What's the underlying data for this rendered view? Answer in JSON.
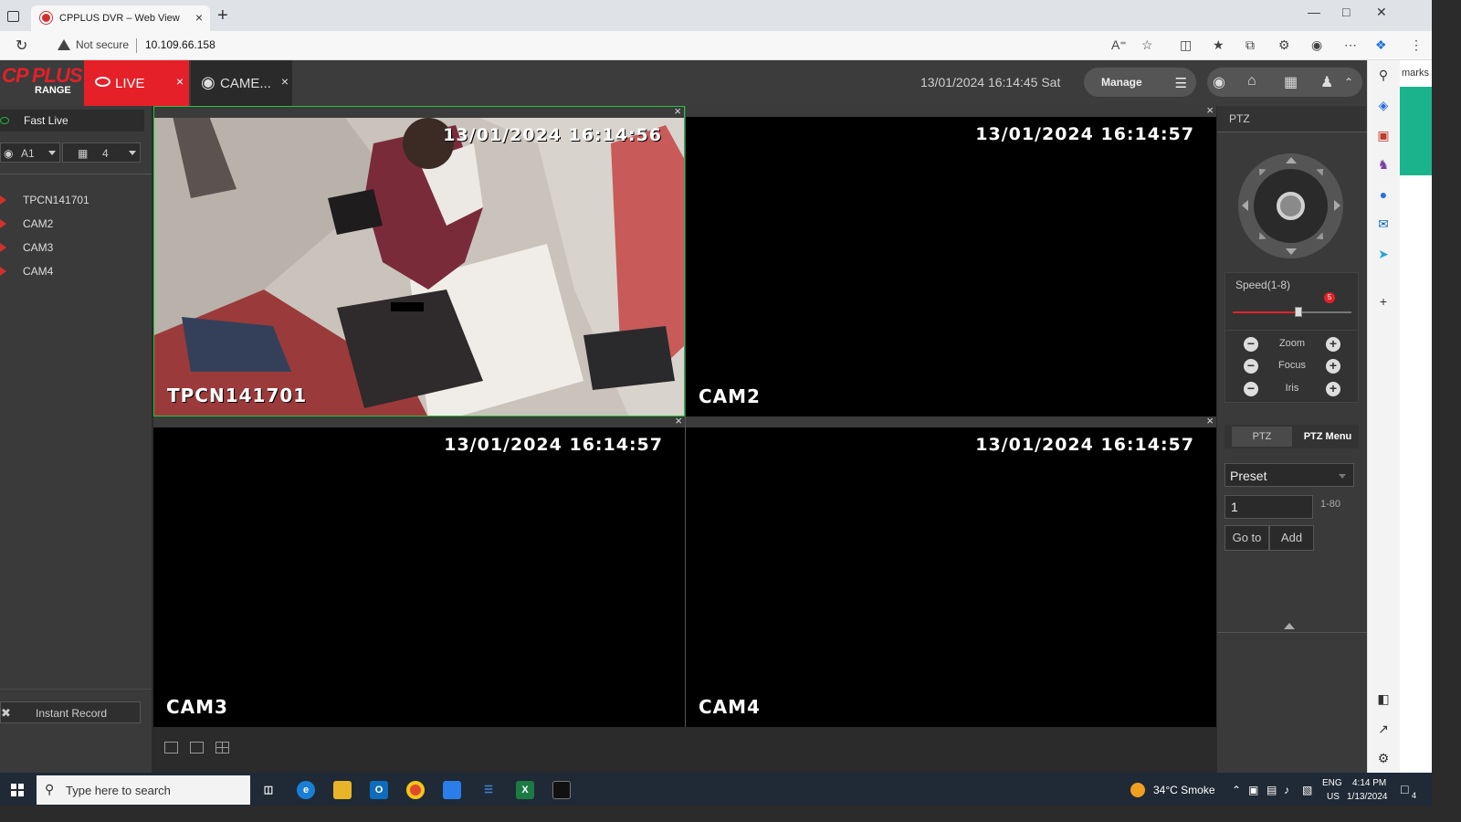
{
  "browser": {
    "tab_title": "CPPLUS DVR – Web View",
    "tab_close": "×",
    "new_tab": "+",
    "not_secure": "Not secure",
    "url": "10.109.66.158",
    "sidebar_partial_text": "marks"
  },
  "app": {
    "logo_brand": "CP PLUS",
    "logo_sub": "RANGE",
    "tabs": [
      {
        "label": "LIVE",
        "close": "×",
        "active": true
      },
      {
        "label": "CAME...",
        "close": "×",
        "active": false
      }
    ],
    "datetime": "13/01/2024 16:14:45 Sat",
    "manage_label": "Manage",
    "accent_color": "#e52028"
  },
  "left_panel": {
    "fast_live": "Fast Live",
    "channel_select": "A1",
    "layout_select": "4",
    "cameras": [
      "TPCN141701",
      "CAM2",
      "CAM3",
      "CAM4"
    ],
    "instant_record": "Instant Record"
  },
  "video_tiles": [
    {
      "timestamp": "13/01/2024 16:14:56",
      "name": "TPCN141701",
      "selected": true,
      "has_feed": true
    },
    {
      "timestamp": "13/01/2024 16:14:57",
      "name": "CAM2",
      "selected": false,
      "has_feed": false
    },
    {
      "timestamp": "13/01/2024 16:14:57",
      "name": "CAM3",
      "selected": false,
      "has_feed": false
    },
    {
      "timestamp": "13/01/2024 16:14:57",
      "name": "CAM4",
      "selected": false,
      "has_feed": false
    }
  ],
  "ptz": {
    "title": "PTZ",
    "speed_label": "Speed(1-8)",
    "speed_value": "5",
    "speed_fraction": 0.55,
    "controls": [
      "Zoom",
      "Focus",
      "Iris"
    ],
    "tab_ptz": "PTZ",
    "tab_ptz_menu": "PTZ Menu",
    "preset_label": "Preset",
    "preset_value": "1",
    "preset_range": "1-80",
    "goto_label": "Go to",
    "add_label": "Add"
  },
  "taskbar": {
    "search_placeholder": "Type here to search",
    "weather": "34°C  Smoke",
    "lang_1": "ENG",
    "lang_2": "US",
    "time": "4:14 PM",
    "date": "1/13/2024",
    "notification_count": "4"
  }
}
